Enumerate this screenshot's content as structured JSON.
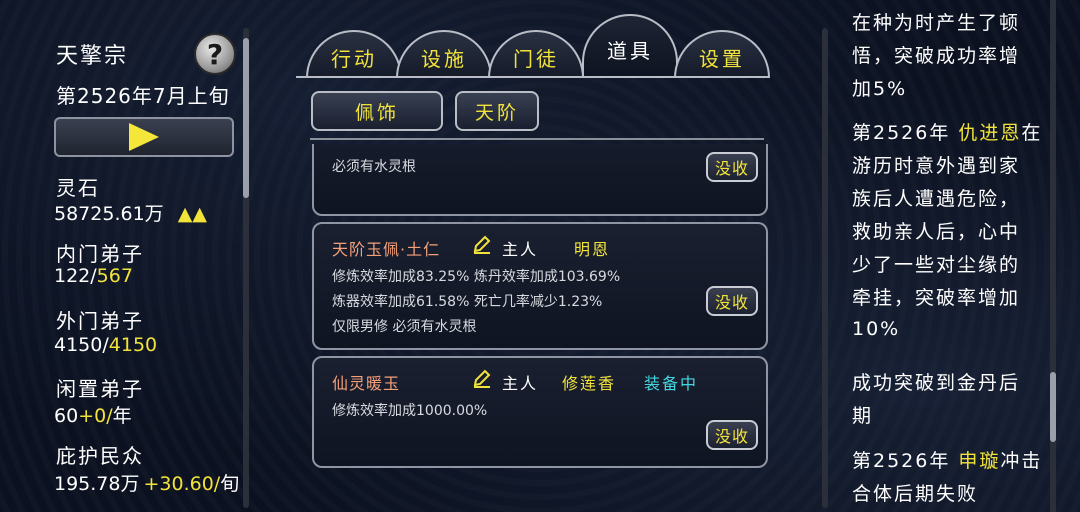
{
  "left": {
    "sect_name": "天擎宗",
    "help_label": "?",
    "date": "第2526年7月上旬",
    "stats": [
      {
        "label": "灵石",
        "value": "58725.61万",
        "extra": "▲▲"
      },
      {
        "label": "内门弟子",
        "value_a": "122/",
        "value_b": "567"
      },
      {
        "label": "外门弟子",
        "value_a": "4150/",
        "value_b": "4150"
      },
      {
        "label": "闲置弟子",
        "value_a": "60",
        "value_b": "+0/",
        "value_c": "年"
      },
      {
        "label": "庇护民众",
        "value_a": "195.78万",
        "value_b": "+30.60/",
        "value_c": "旬"
      }
    ]
  },
  "tabs": [
    {
      "label": "行动",
      "active": false
    },
    {
      "label": "设施",
      "active": false
    },
    {
      "label": "门徒",
      "active": false
    },
    {
      "label": "道具",
      "active": true
    },
    {
      "label": "设置",
      "active": false
    }
  ],
  "subtabs": [
    {
      "label": "佩饰"
    },
    {
      "label": "天阶"
    }
  ],
  "items": [
    {
      "name": "",
      "owner_label": "",
      "owner": "",
      "equipped": "",
      "lines": [
        "必须有水灵根"
      ],
      "reclaim": "没收"
    },
    {
      "name": "天阶玉佩·土仁",
      "owner_label": "主人",
      "owner": "明恩",
      "equipped": "",
      "lines": [
        "修炼效率加成83.25% 炼丹效率加成103.69%",
        "炼器效率加成61.58% 死亡几率减少1.23%",
        "仅限男修 必须有水灵根"
      ],
      "reclaim": "没收"
    },
    {
      "name": "仙灵暖玉",
      "owner_label": "主人",
      "owner": "修莲香",
      "equipped": "装备中",
      "lines": [
        "修炼效率加成1000.00%"
      ],
      "reclaim": "没收"
    }
  ],
  "log": {
    "lines": [
      {
        "t": "在种为时产生了顿"
      },
      {
        "t": "悟，突破成功率增"
      },
      {
        "t": "加5%"
      },
      {
        "a": "第2526年 ",
        "b": "仇进恩",
        "c": "在"
      },
      {
        "t": "游历时意外遇到家"
      },
      {
        "t": "族后人遭遇危险，"
      },
      {
        "t": "救助亲人后，心中"
      },
      {
        "t": "少了一些对尘缘的"
      },
      {
        "t": "牵挂，突破率增加"
      },
      {
        "t": "10%"
      },
      {
        "t": "成功突破到金丹后"
      },
      {
        "t": "期"
      },
      {
        "a": "第2526年 ",
        "b": "申璇",
        "c": "冲击"
      },
      {
        "t": "合体后期失败"
      }
    ]
  },
  "colors": {
    "accent_yellow": "#f2e33b",
    "item_name_orange": "#f5a07a",
    "equipped_cyan": "#45d6e0"
  }
}
